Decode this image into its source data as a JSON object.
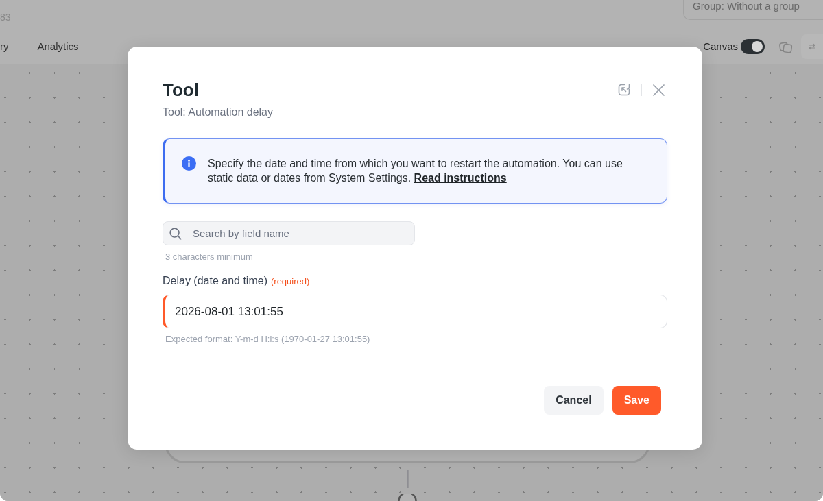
{
  "header": {
    "subtitle": "83",
    "group_select": {
      "value": "Group: Without a group"
    }
  },
  "nav_tabs": [
    {
      "label": "ry",
      "selected": false
    },
    {
      "label": "Analytics",
      "selected": false
    }
  ],
  "toolbar": {
    "canvas_toggle": {
      "label": "Canvas",
      "on": true
    }
  },
  "modal": {
    "title": "Tool",
    "subtitle": "Tool: Automation delay",
    "info": {
      "text": "Specify the date and time from which you want to restart the automation. You can use static data or dates from System Settings.",
      "link": "Read instructions"
    },
    "search": {
      "placeholder": "Search by field name",
      "hint": "3 characters minimum"
    },
    "fields": [
      {
        "label": "Delay (date and time)",
        "required": true,
        "required_label": "(required)",
        "value": "2026-08-01 13:01:55",
        "hint": "Expected format: Y-m-d H:i:s (1970-01-27 13:01:55)"
      }
    ],
    "buttons": [
      {
        "label": "Cancel",
        "kind": "secondary"
      },
      {
        "label": "Save",
        "kind": "primary"
      }
    ]
  }
}
